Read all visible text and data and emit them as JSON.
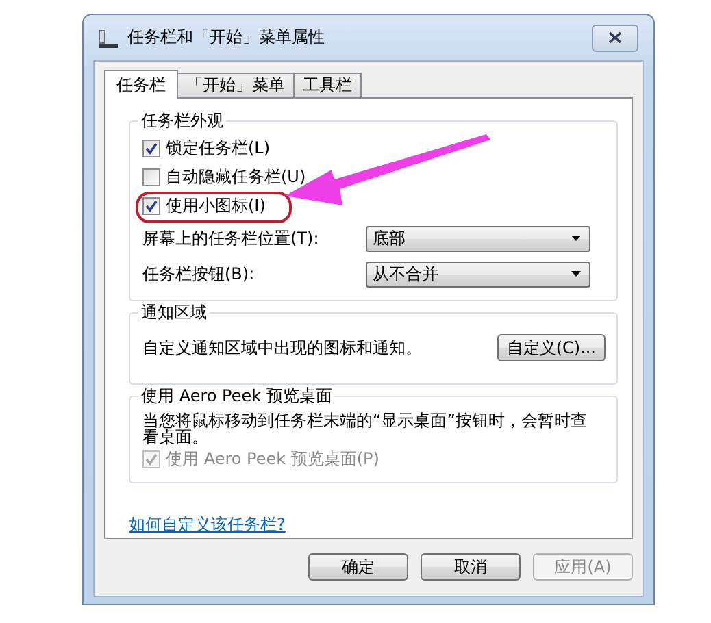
{
  "window": {
    "title": "任务栏和「开始」菜单属性"
  },
  "tabs": [
    {
      "label": "任务栏",
      "selected": true
    },
    {
      "label": "「开始」菜单",
      "selected": false
    },
    {
      "label": "工具栏",
      "selected": false
    }
  ],
  "groups": [
    {
      "title": "任务栏外观",
      "items": [
        {
          "kind": "checkbox",
          "label": "锁定任务栏(L)",
          "checked": true,
          "disabled": false,
          "highlighted": false
        },
        {
          "kind": "checkbox",
          "label": "自动隐藏任务栏(U)",
          "checked": false,
          "disabled": false,
          "highlighted": false
        },
        {
          "kind": "checkbox",
          "label": "使用小图标(I)",
          "checked": true,
          "disabled": false,
          "highlighted": true
        },
        {
          "kind": "dropdown",
          "label": "屏幕上的任务栏位置(T):",
          "value": "底部"
        },
        {
          "kind": "dropdown",
          "label": "任务栏按钮(B):",
          "value": "从不合并"
        }
      ]
    },
    {
      "title": "通知区域",
      "items": [
        {
          "kind": "text_button",
          "text": "自定义通知区域中出现的图标和通知。",
          "button": "自定义(C)..."
        }
      ]
    },
    {
      "title": "使用 Aero Peek 预览桌面",
      "items": [
        {
          "kind": "paragraph",
          "text": "当您将鼠标移动到任务栏末端的“显示桌面”按钮时，会暂时查看桌面。"
        },
        {
          "kind": "checkbox",
          "label": "使用 Aero Peek 预览桌面(P)",
          "checked": true,
          "disabled": true,
          "highlighted": false
        }
      ]
    }
  ],
  "link": "如何自定义该任务栏?",
  "buttons": [
    {
      "label": "确定",
      "disabled": false
    },
    {
      "label": "取消",
      "disabled": false
    },
    {
      "label": "应用(A)",
      "disabled": true
    }
  ]
}
